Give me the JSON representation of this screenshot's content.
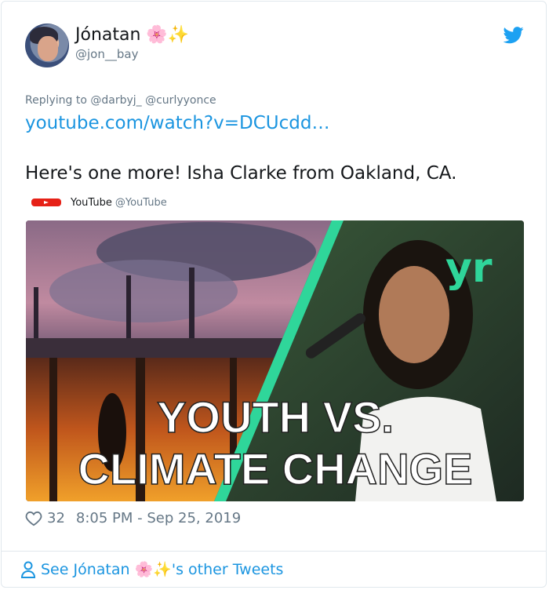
{
  "author": {
    "name": "Jónatan 🌸✨",
    "handle": "@jon__bay"
  },
  "tweet": {
    "replying_to": "Replying to @darbyj_ @curlyyonce",
    "link": "youtube.com/watch?v=DCUcdd…",
    "text": "Here's one more! Isha Clarke from Oakland, CA."
  },
  "embed": {
    "source_name": "YouTube",
    "source_handle": "@YouTube",
    "thumbnail_line1": "YOUTH VS.",
    "thumbnail_line2": "CLIMATE CHANGE",
    "thumbnail_logo": "yr"
  },
  "meta": {
    "likes": "32",
    "timestamp": "8:05 PM - Sep 25, 2019"
  },
  "footer": {
    "see_more": "See Jónatan 🌸✨'s other Tweets"
  },
  "colors": {
    "link": "#1b95e0",
    "muted": "#657786",
    "accent_green": "#2fd69a"
  }
}
